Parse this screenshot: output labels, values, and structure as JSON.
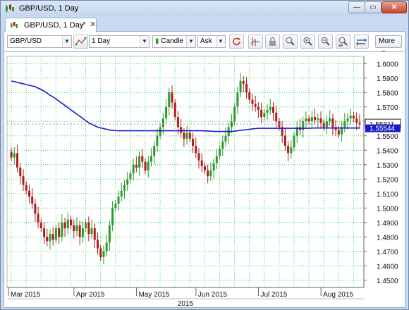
{
  "window": {
    "title": "GBP/USD, 1 Day",
    "minimize_label": "—",
    "restore_label": "▭",
    "close_label": "✕"
  },
  "tab": {
    "label": "GBP/USD, 1 Day",
    "popout_label": "⇗",
    "close_label": "✕"
  },
  "toolbar": {
    "instrument": "GBP/USD",
    "period": "1 Day",
    "chart_type": "Candle",
    "side": "Ask",
    "more_label": "More",
    "icons": [
      "refresh-icon",
      "indicators-icon",
      "lock-icon",
      "zoom-icon",
      "zoom-in-icon",
      "zoom-out-icon",
      "zoom-fit-icon",
      "trade-icon"
    ]
  },
  "colors": {
    "bull": "#2e9a2e",
    "bear": "#b01c1c",
    "ma": "#1a1acc",
    "grid": "#3fd77a"
  },
  "chart_data": {
    "type": "candlestick",
    "title": "",
    "xlabel": "2015",
    "ylabel": "",
    "ylim": [
      1.445,
      1.605
    ],
    "y_ticks": [
      "1.6000",
      "1.5900",
      "1.5800",
      "1.5700",
      "1.5600",
      "1.5500",
      "1.5400",
      "1.5300",
      "1.5200",
      "1.5100",
      "1.5000",
      "1.4900",
      "1.4800",
      "1.4700",
      "1.4600",
      "1.4500"
    ],
    "x_ticks": [
      "Mar 2015",
      "Apr 2015",
      "May 2015",
      "Jun 2015",
      "Jul 2015",
      "Aug 2015"
    ],
    "current_price": "1.55811",
    "ma_value": "1.55544",
    "close": [
      1.535,
      1.538,
      1.528,
      1.522,
      1.516,
      1.512,
      1.508,
      1.503,
      1.496,
      1.49,
      1.486,
      1.48,
      1.477,
      1.482,
      1.478,
      1.486,
      1.48,
      1.49,
      1.486,
      1.492,
      1.488,
      1.484,
      1.488,
      1.48,
      1.486,
      1.49,
      1.482,
      1.486,
      1.478,
      1.472,
      1.466,
      1.47,
      1.476,
      1.488,
      1.5,
      1.503,
      1.508,
      1.512,
      1.516,
      1.52,
      1.524,
      1.53,
      1.528,
      1.536,
      1.532,
      1.526,
      1.532,
      1.536,
      1.543,
      1.55,
      1.556,
      1.562,
      1.57,
      1.58,
      1.573,
      1.563,
      1.556,
      1.552,
      1.548,
      1.552,
      1.548,
      1.543,
      1.538,
      1.533,
      1.529,
      1.526,
      1.522,
      1.526,
      1.531,
      1.536,
      1.541,
      1.546,
      1.55,
      1.556,
      1.56,
      1.57,
      1.58,
      1.588,
      1.586,
      1.58,
      1.575,
      1.572,
      1.57,
      1.568,
      1.563,
      1.566,
      1.568,
      1.57,
      1.566,
      1.56,
      1.556,
      1.55,
      1.543,
      1.538,
      1.542,
      1.55,
      1.556,
      1.554,
      1.56,
      1.562,
      1.56,
      1.563,
      1.561,
      1.562,
      1.559,
      1.556,
      1.56,
      1.562,
      1.556,
      1.554,
      1.551,
      1.556,
      1.56,
      1.562,
      1.564,
      1.562,
      1.559,
      1.558
    ],
    "moving_average": [
      1.588,
      1.5875,
      1.587,
      1.5865,
      1.586,
      1.5855,
      1.585,
      1.5845,
      1.584,
      1.583,
      1.582,
      1.581,
      1.5795,
      1.578,
      1.577,
      1.5755,
      1.574,
      1.5725,
      1.571,
      1.5695,
      1.568,
      1.5665,
      1.565,
      1.5635,
      1.562,
      1.5605,
      1.559,
      1.558,
      1.557,
      1.556,
      1.5555,
      1.555,
      1.5545,
      1.554,
      1.5538,
      1.5536,
      1.5535,
      1.5535,
      1.5535,
      1.5535,
      1.5535,
      1.5535,
      1.5535,
      1.5535,
      1.5535,
      1.5535,
      1.5535,
      1.5535,
      1.5535,
      1.5535,
      1.5535,
      1.5535,
      1.5535,
      1.5535,
      1.5535,
      1.5535,
      1.5535,
      1.5535,
      1.5535,
      1.5535,
      1.5535,
      1.5535,
      1.5535,
      1.5535,
      1.5535,
      1.5534,
      1.5533,
      1.5532,
      1.5531,
      1.553,
      1.553,
      1.553,
      1.553,
      1.553,
      1.553,
      1.5532,
      1.5535,
      1.5538,
      1.554,
      1.5542,
      1.5545,
      1.5548,
      1.555,
      1.5552,
      1.5552,
      1.5552,
      1.5552,
      1.5552,
      1.5552,
      1.5552,
      1.5552,
      1.5552,
      1.5552,
      1.5552,
      1.5552,
      1.5552,
      1.5552,
      1.5552,
      1.5552,
      1.5552,
      1.5552,
      1.5553,
      1.5554,
      1.5554,
      1.5554,
      1.5554,
      1.5554,
      1.5554,
      1.5554,
      1.5554,
      1.5554,
      1.5554,
      1.5554,
      1.5554,
      1.5554,
      1.5554,
      1.5554,
      1.5554
    ]
  }
}
